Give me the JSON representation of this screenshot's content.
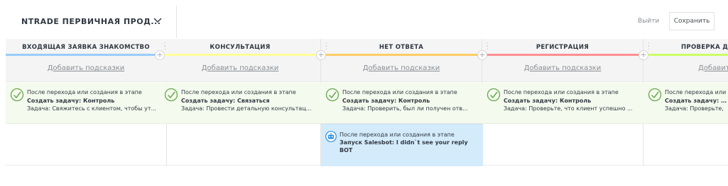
{
  "header": {
    "pipeline_title": "NTRADE ПЕРВИЧНАЯ ПРОД...",
    "exit_label": "Выйти",
    "save_label": "Сохранить"
  },
  "stages": [
    {
      "name": "ВХОДЯЩАЯ ЗАЯВКА ЗНАКОМСТВО",
      "color": "#99ccff",
      "hints": "Добавить подсказки",
      "card": {
        "line1": "После перехода или создания в этапе",
        "line2": "Создать задачу: Контроль",
        "line3": "Задача: Свяжитесь с клиентом, чтобы ут..."
      }
    },
    {
      "name": "КОНСУЛЬТАЦИЯ",
      "color": "#ffff99",
      "hints": "Добавить подсказки",
      "card": {
        "line1": "После перехода или создания в этапе",
        "line2": "Создать задачу: Связаться",
        "line3": "Задача: Провести детальную консультац..."
      }
    },
    {
      "name": "НЕТ ОТВЕТА",
      "color": "#ffcc66",
      "hints": "Добавить подсказки",
      "card": {
        "line1": "После перехода или создания в этапе",
        "line2": "Создать задачу: Контроль",
        "line3": "Задача: Проверить, был ли получен отв..."
      }
    },
    {
      "name": "РЕГИСТРАЦИЯ",
      "color": "#ff8f92",
      "hints": "Добавить подсказки",
      "card": {
        "line1": "После перехода или создания в этапе",
        "line2": "Создать задачу: Контроль",
        "line3": "Задача: Проверьте, что клиент успешно ..."
      }
    },
    {
      "name": "ПРОВЕРКА Д",
      "color": "#ccff66",
      "hints": "Добавить п",
      "card": {
        "line1": "После перехода или",
        "line2": "Создать задачу: Ко",
        "line3": "Задача: Проверьте,"
      }
    }
  ],
  "bot_card": {
    "line1": "После перехода или создания в этапе",
    "line2": "Запуск Salesbot: I didn`t see your reply BOT"
  },
  "icons": {
    "chevron": "chevron-down-icon",
    "task": "check-circle-icon",
    "bot": "robot-icon",
    "drag": "drag-handle-icon",
    "add": "plus-icon"
  },
  "colors": {
    "task_card_bg": "#f4faee",
    "bot_card_bg": "#d4ebfb",
    "check_icon": "#6aa84f",
    "bot_icon": "#2f8fdf"
  }
}
